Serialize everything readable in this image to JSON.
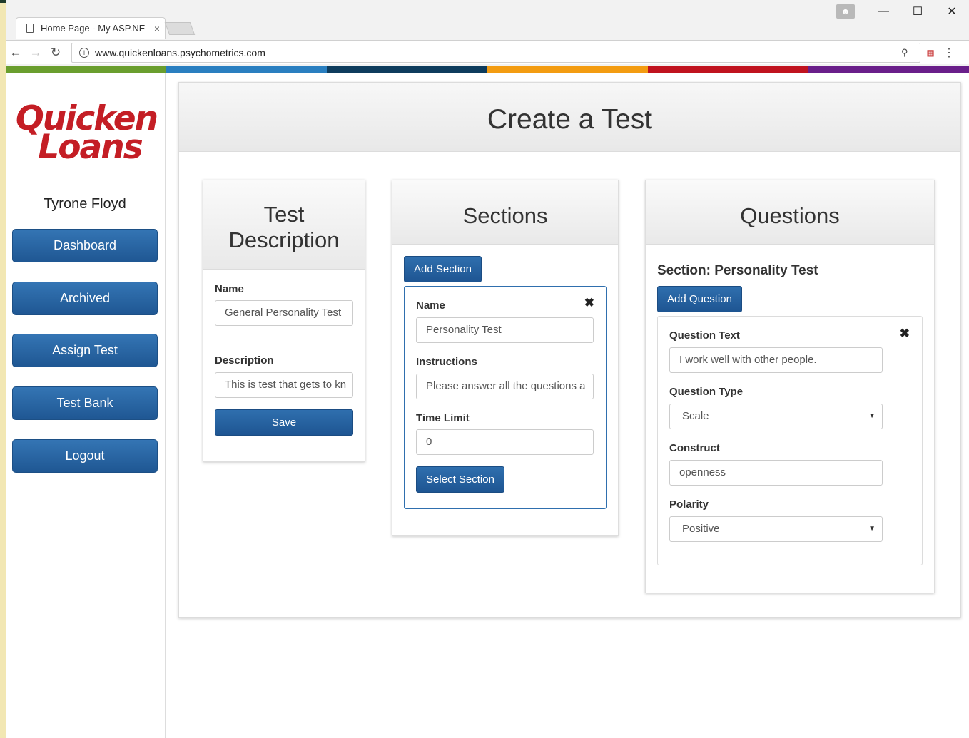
{
  "browser": {
    "tab_title": "Home Page - My ASP.NE",
    "tab_close": "×",
    "url": "www.quickenloans.psychometrics.com",
    "controls": {
      "minimize": "—",
      "maximize": "☐",
      "close": "✕"
    }
  },
  "colors": {
    "stripe": [
      "#6a9e2e",
      "#2a7fc0",
      "#0e3c5d",
      "#f39c12",
      "#c0131f",
      "#6a1f8a"
    ],
    "logo": "#c41e25",
    "button": "#245f9e"
  },
  "sidebar": {
    "logo_line1": "Quicken",
    "logo_line2": "Loans",
    "user_name": "Tyrone Floyd",
    "nav": [
      {
        "label": "Dashboard"
      },
      {
        "label": "Archived"
      },
      {
        "label": "Assign Test"
      },
      {
        "label": "Test Bank"
      },
      {
        "label": "Logout"
      }
    ]
  },
  "main": {
    "title": "Create a Test",
    "description_card": {
      "title_line1": "Test",
      "title_line2": "Description",
      "name_label": "Name",
      "name_value": "General Personality Test",
      "description_label": "Description",
      "description_value": "This is test that gets to kn",
      "save_label": "Save"
    },
    "sections_card": {
      "title": "Sections",
      "add_button": "Add Section",
      "section": {
        "name_label": "Name",
        "name_value": "Personality Test",
        "instructions_label": "Instructions",
        "instructions_value": "Please answer all the questions a",
        "time_limit_label": "Time Limit",
        "time_limit_value": "0",
        "select_button": "Select Section"
      }
    },
    "questions_card": {
      "title": "Questions",
      "section_heading": "Section: Personality Test",
      "add_button": "Add Question",
      "question": {
        "text_label": "Question Text",
        "text_value": "I work well with other people.",
        "type_label": "Question Type",
        "type_value": "Scale",
        "construct_label": "Construct",
        "construct_value": "openness",
        "polarity_label": "Polarity",
        "polarity_value": "Positive"
      }
    }
  }
}
